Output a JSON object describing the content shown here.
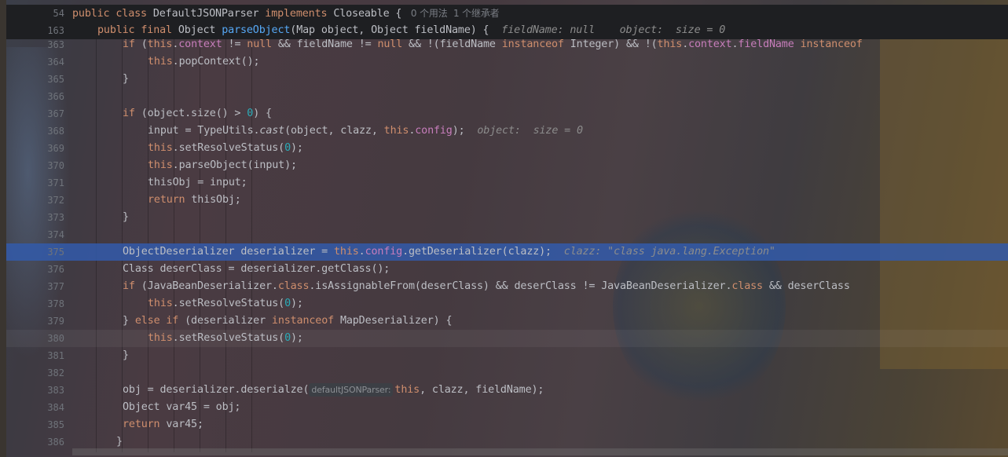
{
  "sticky": [
    {
      "line": "54",
      "indent": 0,
      "tokens": [
        [
          "public class ",
          "kw"
        ],
        [
          "DefaultJSONParser ",
          ""
        ],
        [
          "implements ",
          "kw"
        ],
        [
          "Closeable { ",
          ""
        ]
      ],
      "usages": "0 个用法",
      "inheritors": "1 个继承者"
    },
    {
      "line": "163",
      "indent": 1,
      "tokens": [
        [
          "public final ",
          "kw"
        ],
        [
          "Object ",
          ""
        ],
        [
          "parseObject",
          "fn"
        ],
        [
          "(Map object, Object fieldName) {  ",
          ""
        ],
        [
          "fieldName: null    object:  size = 0",
          "hint"
        ]
      ]
    }
  ],
  "lines": [
    {
      "line": "363",
      "indent": 8,
      "tokens": [
        [
          "if ",
          "kw"
        ],
        [
          "(",
          ""
        ],
        [
          "this",
          "kw"
        ],
        [
          ".",
          ""
        ],
        [
          "context",
          "fld"
        ],
        [
          " != ",
          ""
        ],
        [
          "null",
          "kw"
        ],
        [
          " && fieldName != ",
          ""
        ],
        [
          "null",
          "kw"
        ],
        [
          " && !(fieldName ",
          ""
        ],
        [
          "instanceof ",
          "kw"
        ],
        [
          "Integer) && !(",
          ""
        ],
        [
          "this",
          "kw"
        ],
        [
          ".",
          ""
        ],
        [
          "context",
          "fld"
        ],
        [
          ".",
          ""
        ],
        [
          "fieldName",
          "fld"
        ],
        [
          " ",
          ""
        ],
        [
          "instanceof",
          "kw"
        ]
      ]
    },
    {
      "line": "364",
      "indent": 12,
      "tokens": [
        [
          "this",
          "kw"
        ],
        [
          ".popContext();",
          ""
        ]
      ]
    },
    {
      "line": "365",
      "indent": 8,
      "tokens": [
        [
          "}",
          ""
        ]
      ]
    },
    {
      "line": "366",
      "indent": 8,
      "tokens": []
    },
    {
      "line": "367",
      "indent": 8,
      "tokens": [
        [
          "if ",
          "kw"
        ],
        [
          "(object.size() > ",
          ""
        ],
        [
          "0",
          "num"
        ],
        [
          ") {",
          ""
        ]
      ]
    },
    {
      "line": "368",
      "indent": 12,
      "tokens": [
        [
          "input = TypeUtils.",
          ""
        ],
        [
          "cast",
          "ital"
        ],
        [
          "(object, clazz, ",
          ""
        ],
        [
          "this",
          "kw"
        ],
        [
          ".",
          ""
        ],
        [
          "config",
          "fld"
        ],
        [
          ");  ",
          ""
        ],
        [
          "object:  size = 0",
          "hint"
        ]
      ]
    },
    {
      "line": "369",
      "indent": 12,
      "tokens": [
        [
          "this",
          "kw"
        ],
        [
          ".setResolveStatus(",
          ""
        ],
        [
          "0",
          "num"
        ],
        [
          ");",
          ""
        ]
      ]
    },
    {
      "line": "370",
      "indent": 12,
      "tokens": [
        [
          "this",
          "kw"
        ],
        [
          ".parseObject(input);",
          ""
        ]
      ]
    },
    {
      "line": "371",
      "indent": 12,
      "tokens": [
        [
          "thisObj = input;",
          ""
        ]
      ]
    },
    {
      "line": "372",
      "indent": 12,
      "tokens": [
        [
          "return ",
          "kw"
        ],
        [
          "thisObj;",
          ""
        ]
      ]
    },
    {
      "line": "373",
      "indent": 8,
      "tokens": [
        [
          "}",
          ""
        ]
      ]
    },
    {
      "line": "374",
      "indent": 8,
      "tokens": []
    },
    {
      "line": "375",
      "indent": 8,
      "state": "selected",
      "tokens": [
        [
          "ObjectDeserializer deserializer = ",
          ""
        ],
        [
          "this",
          "kw"
        ],
        [
          ".",
          ""
        ],
        [
          "config",
          "fld"
        ],
        [
          ".getDeserializer(clazz);  ",
          ""
        ],
        [
          "clazz: \"class java.lang.Exception\"",
          "hint"
        ]
      ]
    },
    {
      "line": "376",
      "indent": 8,
      "tokens": [
        [
          "Class deserClass = deserializer.getClass();",
          ""
        ]
      ]
    },
    {
      "line": "377",
      "indent": 8,
      "tokens": [
        [
          "if ",
          "kw"
        ],
        [
          "(JavaBeanDeserializer.",
          ""
        ],
        [
          "class",
          "kw"
        ],
        [
          ".isAssignableFrom(deserClass) && deserClass != JavaBeanDeserializer.",
          ""
        ],
        [
          "class ",
          "kw"
        ],
        [
          "&& deserClass",
          ""
        ]
      ]
    },
    {
      "line": "378",
      "indent": 12,
      "tokens": [
        [
          "this",
          "kw"
        ],
        [
          ".setResolveStatus(",
          ""
        ],
        [
          "0",
          "num"
        ],
        [
          ");",
          ""
        ]
      ]
    },
    {
      "line": "379",
      "indent": 8,
      "tokens": [
        [
          "} ",
          ""
        ],
        [
          "else if ",
          "kw"
        ],
        [
          "(deserializer ",
          ""
        ],
        [
          "instanceof ",
          "kw"
        ],
        [
          "MapDeserializer) {",
          ""
        ]
      ]
    },
    {
      "line": "380",
      "indent": 12,
      "state": "current",
      "tokens": [
        [
          "this",
          "kw"
        ],
        [
          ".setResolveStatus(",
          ""
        ],
        [
          "0",
          "num"
        ],
        [
          ");",
          ""
        ]
      ]
    },
    {
      "line": "381",
      "indent": 8,
      "tokens": [
        [
          "}",
          ""
        ]
      ]
    },
    {
      "line": "382",
      "indent": 8,
      "tokens": []
    },
    {
      "line": "383",
      "indent": 8,
      "tokens": [
        [
          "obj = deserializer.deserialze(",
          ""
        ],
        [
          "defaultJSONParser:",
          "param"
        ],
        [
          "this",
          "kw"
        ],
        [
          ", clazz, fieldName);",
          ""
        ]
      ]
    },
    {
      "line": "384",
      "indent": 8,
      "tokens": [
        [
          "Object var45 = obj;",
          ""
        ]
      ]
    },
    {
      "line": "385",
      "indent": 8,
      "tokens": [
        [
          "return ",
          "kw"
        ],
        [
          "var45;",
          ""
        ]
      ]
    },
    {
      "line": "386",
      "indent": 7,
      "tokens": [
        [
          "}",
          ""
        ]
      ]
    }
  ]
}
